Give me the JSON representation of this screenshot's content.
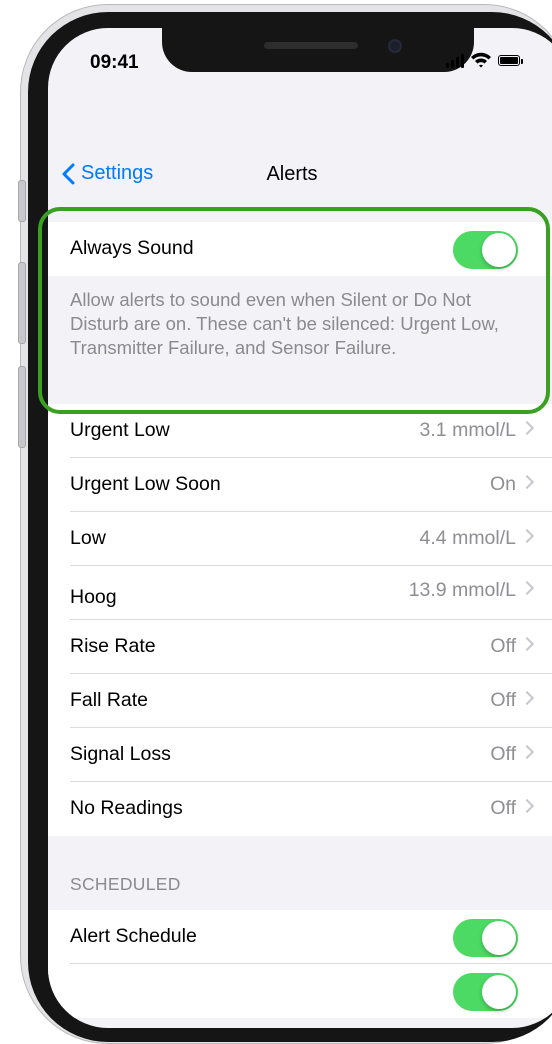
{
  "status_bar": {
    "time": "09:41"
  },
  "nav": {
    "back_label": "Settings",
    "title": "Alerts"
  },
  "always_sound": {
    "label": "Always Sound",
    "enabled": true,
    "description": "Allow alerts to sound even when Silent or Do Not Disturb are on. These can't be silenced: Urgent Low, Transmitter Failure, and Sensor Failure."
  },
  "alerts": [
    {
      "label": "Urgent Low",
      "value": "3.1 mmol/L"
    },
    {
      "label": "Urgent Low Soon",
      "value": "On"
    },
    {
      "label": "Low",
      "value": "4.4 mmol/L"
    },
    {
      "label": "Hoog",
      "value": "13.9 mmol/L"
    },
    {
      "label": "Rise Rate",
      "value": "Off"
    },
    {
      "label": "Fall Rate",
      "value": "Off"
    },
    {
      "label": "Signal Loss",
      "value": "Off"
    },
    {
      "label": "No Readings",
      "value": "Off"
    }
  ],
  "scheduled": {
    "header": "SCHEDULED",
    "alert_schedule_label": "Alert Schedule",
    "alert_schedule_enabled": true
  },
  "colors": {
    "accent": "#007aff",
    "toggle_on": "#4cd964",
    "highlight": "#3aa021"
  }
}
